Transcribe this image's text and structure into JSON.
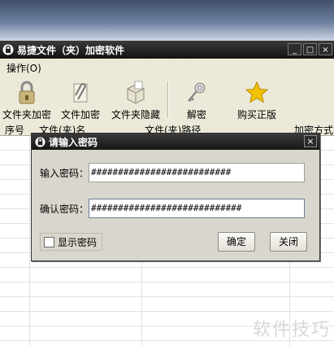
{
  "window": {
    "title": "易捷文件（夹）加密软件",
    "buttons": [
      "_",
      "□",
      "×"
    ]
  },
  "menu": {
    "operate": "操作(O)"
  },
  "toolbar": {
    "items": [
      {
        "label": "文件夹加密",
        "icon": "lock-icon"
      },
      {
        "label": "文件加密",
        "icon": "paperclip-icon"
      },
      {
        "label": "文件夹隐藏",
        "icon": "box-icon"
      },
      {
        "label": "解密",
        "icon": "key-icon"
      },
      {
        "label": "购买正版",
        "icon": "star-icon"
      }
    ]
  },
  "table": {
    "columns": [
      "序号",
      "文件(夹)名",
      "文件(夹)路径",
      "加密方式"
    ]
  },
  "dialog": {
    "title": "请输入密码",
    "close": "×",
    "password_label": "输入密码：",
    "password_value": "##########################",
    "confirm_label": "确认密码：",
    "confirm_value": "############################",
    "show_password": "显示密码",
    "ok": "确定",
    "close_button": "关闭"
  },
  "watermark": "软件技巧",
  "colors": {
    "star": "#f2c200",
    "titlebar": "#1a1a1a"
  }
}
